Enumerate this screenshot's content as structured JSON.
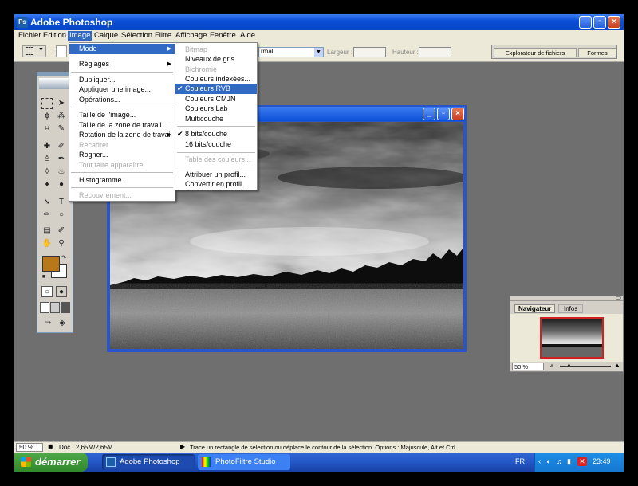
{
  "window": {
    "title": "Adobe Photoshop",
    "app_icon": "photoshop-icon"
  },
  "menubar": {
    "items": [
      "Fichier",
      "Edition",
      "Image",
      "Calque",
      "Sélection",
      "Filtre",
      "Affichage",
      "Fenêtre",
      "Aide"
    ],
    "active": "Image"
  },
  "optionsbar": {
    "mode_value": "rmal",
    "largeur_label": "Largeur :",
    "hauteur_label": "Hauteur :",
    "tabs": [
      "Explorateur de fichiers",
      "Formes"
    ]
  },
  "image_menu": {
    "items": [
      {
        "label": "Mode",
        "submenu": true,
        "highlighted": true
      },
      {
        "label": "Réglages",
        "submenu": true
      },
      {
        "label": "Dupliquer..."
      },
      {
        "label": "Appliquer une image..."
      },
      {
        "label": "Opérations..."
      },
      {
        "label": "Taille de l'image..."
      },
      {
        "label": "Taille de la zone de travail..."
      },
      {
        "label": "Rotation de la zone de travail",
        "submenu": true
      },
      {
        "label": "Recadrer",
        "disabled": true
      },
      {
        "label": "Rogner..."
      },
      {
        "label": "Tout faire apparaître",
        "disabled": true
      },
      {
        "label": "Histogramme..."
      },
      {
        "label": "Recouvrement...",
        "disabled": true
      }
    ]
  },
  "mode_submenu": {
    "items": [
      {
        "label": "Bitmap",
        "disabled": true
      },
      {
        "label": "Niveaux de gris"
      },
      {
        "label": "Bichromie",
        "disabled": true
      },
      {
        "label": "Couleurs indexées..."
      },
      {
        "label": "Couleurs RVB",
        "checked": true,
        "highlighted": true
      },
      {
        "label": "Couleurs CMJN"
      },
      {
        "label": "Couleurs Lab"
      },
      {
        "label": "Multicouche"
      },
      {
        "label": "8 bits/couche",
        "checked": true
      },
      {
        "label": "16 bits/couche"
      },
      {
        "label": "Table des couleurs...",
        "disabled": true
      },
      {
        "label": "Attribuer un profil..."
      },
      {
        "label": "Convertir en profil..."
      }
    ]
  },
  "navigator": {
    "tabs": [
      "Navigateur",
      "Infos"
    ],
    "zoom": "50 %"
  },
  "statusbar": {
    "zoom": "50 %",
    "doc": "Doc : 2,65M/2,65M",
    "hint": "Trace un rectangle de sélection ou déplace le contour de la sélection. Options : Majuscule, Alt et Ctrl."
  },
  "taskbar": {
    "start": "démarrer",
    "tasks": [
      "Adobe Photoshop",
      "PhotoFiltre Studio"
    ],
    "lang": "FR",
    "time": "23:49"
  },
  "colors": {
    "foreground": "#b8781a",
    "background": "#ffffff",
    "accent": "#316ac5"
  }
}
